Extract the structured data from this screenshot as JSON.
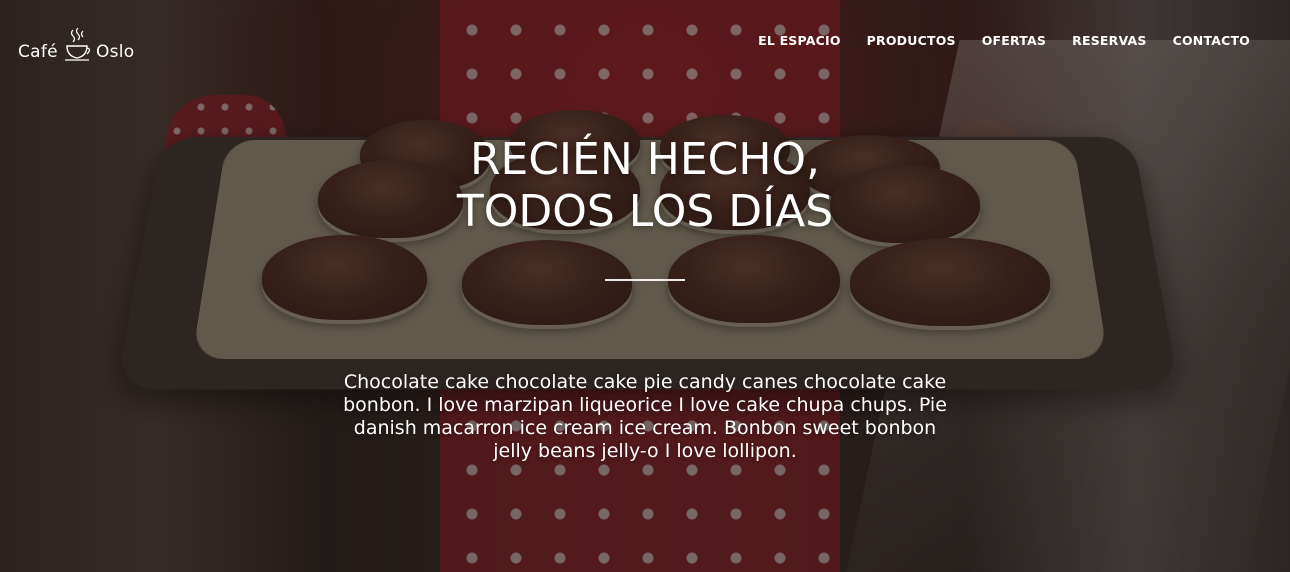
{
  "brand": {
    "name_left": "Café",
    "name_right": "Oslo",
    "logo_icon": "coffee-cup-icon"
  },
  "nav": {
    "items": [
      {
        "label": "EL ESPACIO"
      },
      {
        "label": "PRODUCTOS"
      },
      {
        "label": "OFERTAS"
      },
      {
        "label": "RESERVAS"
      },
      {
        "label": "CONTACTO"
      }
    ]
  },
  "hero": {
    "title_line1": "RECIÉN HECHO,",
    "title_line2": "TODOS LOS DÍAS",
    "description": "Chocolate cake chocolate cake pie candy canes chocolate cake bonbon. I love marzipan liqueorice I love cake chupa chups. Pie danish macarron ice cream ice cream. Bonbon sweet bonbon jelly beans jelly-o I love lollipon."
  },
  "colors": {
    "text": "#ffffff",
    "apron_red": "#8e1f2a",
    "tray": "#3d3431"
  }
}
